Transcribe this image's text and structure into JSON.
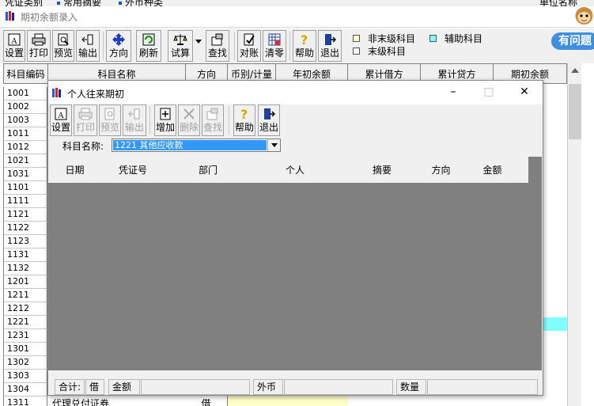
{
  "top_menu": [
    "凭证类别",
    "常用摘要",
    "外币种类",
    "单位名称"
  ],
  "main_window": {
    "title": "期初余额录入"
  },
  "toolbar": [
    {
      "label": "设置",
      "icon": "settings-icon"
    },
    {
      "label": "打印",
      "icon": "printer-icon"
    },
    {
      "label": "预览",
      "icon": "preview-icon"
    },
    {
      "label": "输出",
      "icon": "export-icon"
    },
    {
      "label": "方向",
      "icon": "direction-icon"
    },
    {
      "label": "刷新",
      "icon": "refresh-icon"
    },
    {
      "label": "试算",
      "icon": "balance-icon"
    },
    {
      "label": "查找",
      "icon": "find-icon"
    },
    {
      "label": "对账",
      "icon": "reconcile-icon"
    },
    {
      "label": "清零",
      "icon": "clear-icon"
    },
    {
      "label": "帮助",
      "icon": "help-icon"
    },
    {
      "label": "退出",
      "icon": "exit-icon"
    }
  ],
  "legend": {
    "non_leaf": "非末级科目",
    "leaf": "末级科目",
    "auxiliary": "辅助科目",
    "non_leaf_color": "#ffffcc",
    "auxiliary_color": "#80ffff",
    "leaf_color": "#ffffff"
  },
  "help_badge": "有问题",
  "main_grid": {
    "columns": [
      "科目编码",
      "科目名称",
      "方向",
      "币别/计量",
      "年初余额",
      "累计借方",
      "累计贷方",
      "期初余额"
    ],
    "codes": [
      "1001",
      "1002",
      "1003",
      "1011",
      "1012",
      "1021",
      "1031",
      "1101",
      "1111",
      "1121",
      "1122",
      "1123",
      "1131",
      "1132",
      "1201",
      "1211",
      "1212",
      "1221",
      "1231",
      "1301",
      "1302",
      "1303",
      "1304",
      "1311"
    ],
    "last_row_name": "代理兑付证券",
    "last_row_direction": "借"
  },
  "dialog": {
    "title": "个人往来期初",
    "toolbar": [
      {
        "label": "设置",
        "icon": "settings-icon",
        "enabled": true
      },
      {
        "label": "打印",
        "icon": "printer-icon",
        "enabled": false
      },
      {
        "label": "预览",
        "icon": "preview-icon",
        "enabled": false
      },
      {
        "label": "输出",
        "icon": "export-icon",
        "enabled": false
      },
      {
        "label": "增加",
        "icon": "add-icon",
        "enabled": true
      },
      {
        "label": "删除",
        "icon": "delete-icon",
        "enabled": false
      },
      {
        "label": "查找",
        "icon": "find-icon",
        "enabled": false
      },
      {
        "label": "帮助",
        "icon": "help-icon",
        "enabled": true
      },
      {
        "label": "退出",
        "icon": "exit-icon",
        "enabled": true
      }
    ],
    "account_label": "科目名称:",
    "account_value": "1221 其他应收款",
    "columns": [
      "日期",
      "凭证号",
      "部门",
      "个人",
      "摘要",
      "方向",
      "金额"
    ],
    "totals": {
      "sum_label": "合计:",
      "direction": "借",
      "amount_label": "金额",
      "currency_label": "外币",
      "quantity_label": "数量"
    }
  }
}
